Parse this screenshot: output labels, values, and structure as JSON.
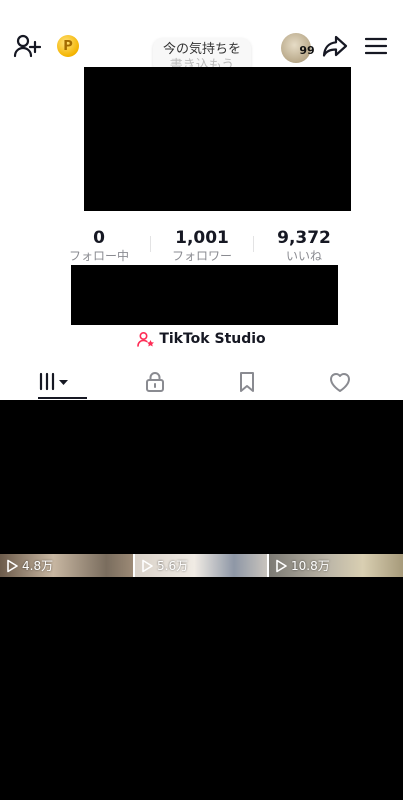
{
  "header": {
    "mood_placeholder_line1": "今の気持ちを",
    "mood_placeholder_line2": "書き込もう",
    "stories_count": "99",
    "coin_symbol": "P"
  },
  "stats": [
    {
      "value": "0",
      "label": "フォロー中"
    },
    {
      "value": "1,001",
      "label": "フォロワー"
    },
    {
      "value": "9,372",
      "label": "いいね"
    }
  ],
  "studio": {
    "label": "TikTok Studio"
  },
  "tabs": [
    {
      "icon": "grid-icon"
    },
    {
      "icon": "lock-icon"
    },
    {
      "icon": "bookmark-icon"
    },
    {
      "icon": "heart-icon"
    }
  ],
  "videos": [
    {
      "views": "4.8万"
    },
    {
      "views": "5.6万"
    },
    {
      "views": "10.8万"
    }
  ],
  "colors": {
    "studio_accent": "#fe2c55",
    "text": "#161823",
    "muted": "#8a8b91"
  }
}
